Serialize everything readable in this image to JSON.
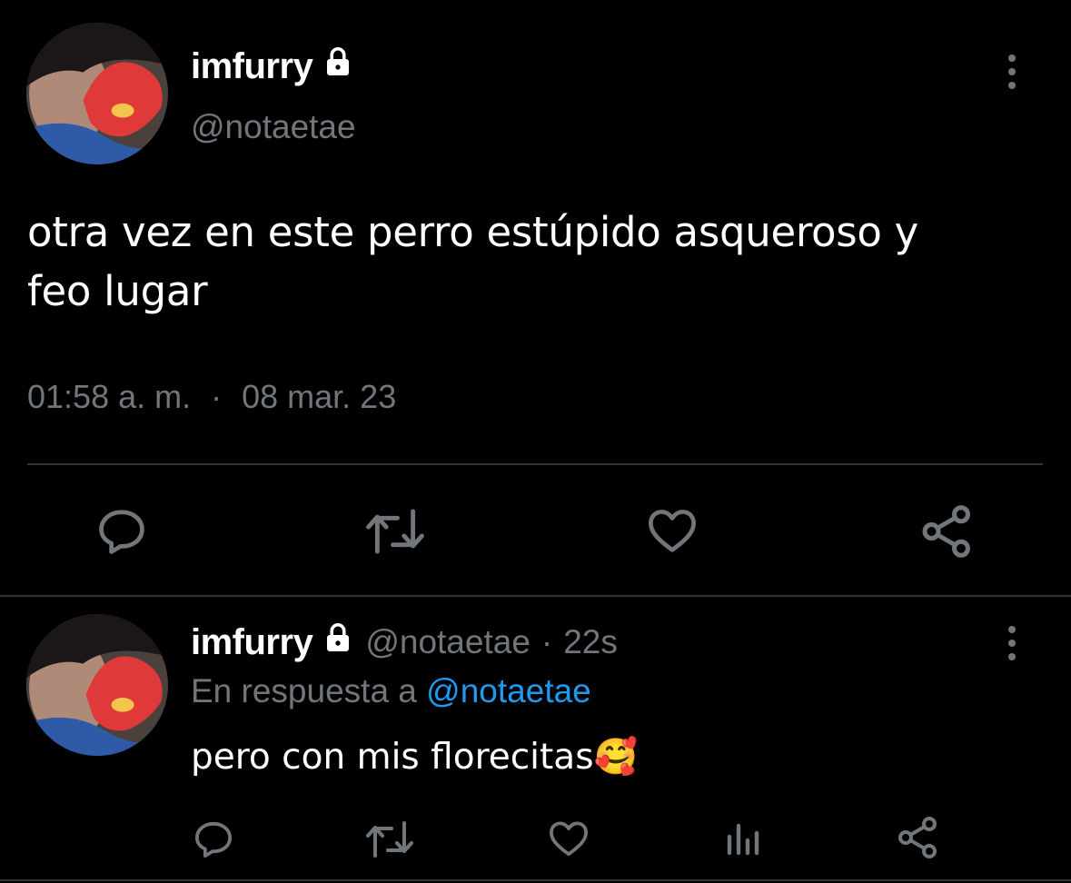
{
  "main_tweet": {
    "display_name": "imfurry",
    "handle": "@notaetae",
    "text_line1": "otra vez en este perro estúpido asqueroso y",
    "text_line2": "feo lugar",
    "time": "01:58 a. m.",
    "separator": "·",
    "date": "08 mar. 23"
  },
  "reply_tweet": {
    "display_name": "imfurry",
    "handle": "@notaetae",
    "separator": "·",
    "age": "22s",
    "reply_prefix": "En respuesta a",
    "reply_to": "@notaetae",
    "text": "pero con mis florecitas",
    "emoji": "🥰"
  },
  "icons": {
    "lock": "lock-icon",
    "more": "more-vertical-icon",
    "reply": "reply-bubble-icon",
    "retweet": "retweet-icon",
    "like": "heart-icon",
    "share": "share-icon",
    "views": "analytics-icon"
  },
  "colors": {
    "background": "#000000",
    "text": "#e7e9ea",
    "muted": "#71767b",
    "link": "#1d9bf0",
    "divider": "#2f3336"
  }
}
